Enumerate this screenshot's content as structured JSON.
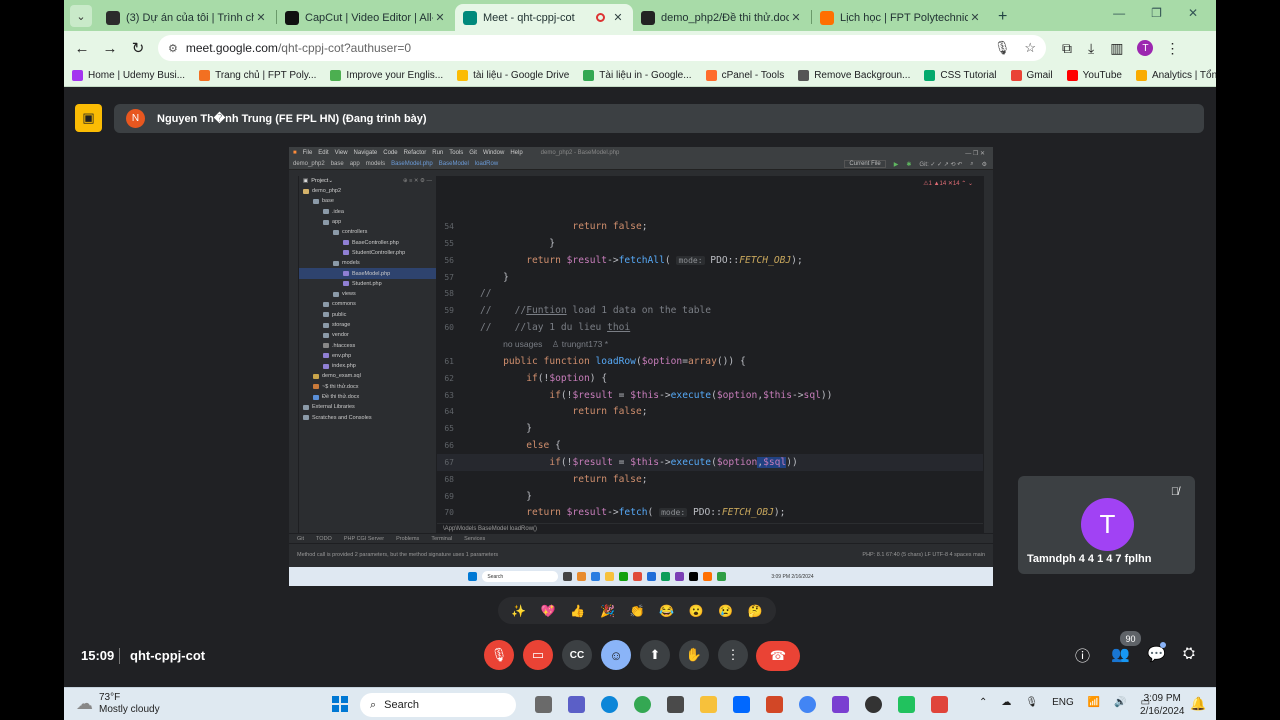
{
  "browser": {
    "tabs": [
      {
        "label": "(3) Dự án của tôi | Trình chỉnh",
        "color": "#2c2c2c"
      },
      {
        "label": "CapCut | Video Editor | All-In-O",
        "color": "#111"
      },
      {
        "label": "Meet - qht-cppj-cot",
        "color": "#00897b",
        "active": true
      },
      {
        "label": "demo_php2/Đề thi thử.docx at",
        "color": "#222"
      },
      {
        "label": "Lịch học | FPT Polytechnic",
        "color": "#ff6f00"
      }
    ],
    "url_host": "meet.google.com",
    "url_path": "/qht-cppj-cot?authuser=0",
    "profile_letter": "T",
    "bookmarks": [
      {
        "label": "Home | Udemy Busi...",
        "color": "#a435f0"
      },
      {
        "label": "Trang chủ | FPT Poly...",
        "color": "#f37021"
      },
      {
        "label": "Improve your Englis...",
        "color": "#4caf50"
      },
      {
        "label": "tài liệu - Google Drive",
        "color": "#fbbc04"
      },
      {
        "label": "Tài liệu in - Google...",
        "color": "#34a853"
      },
      {
        "label": "cPanel - Tools",
        "color": "#ff6c2c"
      },
      {
        "label": "Remove Backgroun...",
        "color": "#555"
      },
      {
        "label": "CSS Tutorial",
        "color": "#04aa6d"
      },
      {
        "label": "Gmail",
        "color": "#ea4335"
      },
      {
        "label": "YouTube",
        "color": "#ff0000"
      },
      {
        "label": "Analytics | Tổng qua...",
        "color": "#f9ab00"
      }
    ]
  },
  "meet": {
    "presenter_initial": "N",
    "presenter_text": "Nguyen Th�nh Trung (FE FPL HN) (Đang trình bày)",
    "time": "15:09",
    "meeting_code": "qht-cppj-cot",
    "participant_count": "90",
    "tile": {
      "initial": "T",
      "name": "Tamndph 4 4 1 4 7 fplhn"
    }
  },
  "ide": {
    "menu": [
      "File",
      "Edit",
      "View",
      "Navigate",
      "Code",
      "Refactor",
      "Run",
      "Tools",
      "Git",
      "Window",
      "Help"
    ],
    "title": "demo_php2 - BaseModel.php",
    "crumbs": [
      "demo_php2",
      "base",
      "app",
      "models",
      "BaseModel.php",
      "BaseModel",
      "loadRow"
    ],
    "run_config": "Current File",
    "project_label": "Project",
    "tree": [
      {
        "label": "demo_php2",
        "indent": 0,
        "color": "#d4b26a"
      },
      {
        "label": "base",
        "indent": 1,
        "color": "#8b9aa8"
      },
      {
        "label": ".idea",
        "indent": 2,
        "color": "#8b9aa8"
      },
      {
        "label": "app",
        "indent": 2,
        "color": "#8b9aa8"
      },
      {
        "label": "controllers",
        "indent": 3,
        "color": "#8b9aa8"
      },
      {
        "label": "BaseController.php",
        "indent": 4,
        "color": "#8f7fd4"
      },
      {
        "label": "StudentController.php",
        "indent": 4,
        "color": "#8f7fd4"
      },
      {
        "label": "models",
        "indent": 3,
        "color": "#8b9aa8"
      },
      {
        "label": "BaseModel.php",
        "indent": 4,
        "color": "#8f7fd4",
        "sel": true
      },
      {
        "label": "Student.php",
        "indent": 4,
        "color": "#8f7fd4"
      },
      {
        "label": "views",
        "indent": 3,
        "color": "#8b9aa8"
      },
      {
        "label": "commons",
        "indent": 2,
        "color": "#8b9aa8"
      },
      {
        "label": "public",
        "indent": 2,
        "color": "#8b9aa8"
      },
      {
        "label": "storage",
        "indent": 2,
        "color": "#8b9aa8"
      },
      {
        "label": "vendor",
        "indent": 2,
        "color": "#8b9aa8"
      },
      {
        "label": ".htaccess",
        "indent": 2,
        "color": "#888"
      },
      {
        "label": "env.php",
        "indent": 2,
        "color": "#8f7fd4"
      },
      {
        "label": "index.php",
        "indent": 2,
        "color": "#8f7fd4"
      },
      {
        "label": "demo_exam.sql",
        "indent": 1,
        "color": "#c9a44a"
      },
      {
        "label": "~$ thi thử.docx",
        "indent": 1,
        "color": "#c97a3a"
      },
      {
        "label": "Đề thi thử.docx",
        "indent": 1,
        "color": "#5a8fd8"
      },
      {
        "label": "External Libraries",
        "indent": 0,
        "color": "#8b9aa8"
      },
      {
        "label": "Scratches and Consoles",
        "indent": 0,
        "color": "#8b9aa8"
      }
    ],
    "lines": [
      {
        "n": "54",
        "html": "                <span class=\"kw\">return</span> <span class=\"kw\">false</span>;"
      },
      {
        "n": "55",
        "html": "            }"
      },
      {
        "n": "56",
        "html": "        <span class=\"kw\">return</span> <span class=\"var\">$result</span>-><span class=\"fn\">fetchAll</span>( <span class=\"hint\">mode:</span> PDO::<span class=\"it\">FETCH_OBJ</span>);"
      },
      {
        "n": "57",
        "html": "    }"
      },
      {
        "n": "58",
        "html": "<span class=\"cm\">//</span>"
      },
      {
        "n": "59",
        "html": "<span class=\"cm\">//    //<u>Funtion</u> load 1 data on the table</span>"
      },
      {
        "n": "60",
        "html": "<span class=\"cm\">//    //lay 1 du lieu <u>thoi</u></span>"
      },
      {
        "n": "",
        "html": "    <span class=\"cm\" style=\"font-family:'Liberation Sans',sans-serif;font-size:8.5px\">no usages    ♙ trungnt173 *</span>"
      },
      {
        "n": "61",
        "html": "    <span class=\"kw\">public function</span> <span class=\"fn\">loadRow</span>(<span class=\"var\">$option</span>=<span class=\"kw\">array</span>()) {"
      },
      {
        "n": "62",
        "html": "        <span class=\"kw\">if</span>(!<span class=\"var\">$option</span>) {"
      },
      {
        "n": "63",
        "html": "            <span class=\"kw\">if</span>(!<span class=\"var\">$result</span> = <span class=\"var\">$this</span>-><span class=\"fn\">execute</span>(<span class=\"var\">$option</span>,<span class=\"var\">$this</span>-><span class=\"var\">sql</span>))"
      },
      {
        "n": "64",
        "html": "                <span class=\"kw\">return</span> <span class=\"kw\">false</span>;"
      },
      {
        "n": "65",
        "html": "        }"
      },
      {
        "n": "66",
        "html": "        <span class=\"kw\">else</span> {"
      },
      {
        "n": "67",
        "html": "            <span class=\"kw\">if</span>(!<span class=\"var\">$result</span> = <span class=\"var\">$this</span>-><span class=\"fn\">execute</span>(<span class=\"var\">$option</span><span class=\"selt\">,<span class=\"var\">$sql</span></span>))",
        "cur": true
      },
      {
        "n": "68",
        "html": "                <span class=\"kw\">return</span> <span class=\"kw\">false</span>;"
      },
      {
        "n": "69",
        "html": "        }"
      },
      {
        "n": "70",
        "html": "        <span class=\"kw\">return</span> <span class=\"var\">$result</span>-><span class=\"fn\">fetch</span>( <span class=\"hint\">mode:</span> PDO::<span class=\"it\">FETCH_OBJ</span>);"
      },
      {
        "n": "71",
        "html": "    }"
      },
      {
        "n": "72",
        "html": "}"
      }
    ],
    "editor_crumbs": "\\App\\Models    BaseModel    loadRow()",
    "bottom_tabs": [
      "Git",
      "TODO",
      "PHP CGI Server",
      "Problems",
      "Terminal",
      "Services"
    ],
    "status_msg": "Method call is provided 2 parameters, but the method signature uses 1 parameters",
    "status_right": "PHP: 8.1    67:40 (5 chars)    LF    UTF-8    4 spaces    main",
    "inner_search": "Search",
    "inner_clock": "3:09 PM 2/16/2024"
  },
  "taskbar": {
    "temp": "73°F",
    "weather": "Mostly cloudy",
    "search": "Search",
    "lang": "ENG",
    "time": "3:09 PM",
    "date": "2/16/2024"
  }
}
